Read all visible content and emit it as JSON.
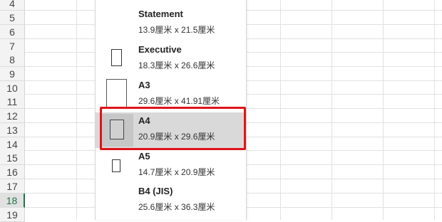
{
  "row_numbers": [
    "4",
    "5",
    "6",
    "7",
    "8",
    "9",
    "10",
    "11",
    "12",
    "13",
    "14",
    "15",
    "16",
    "17",
    "18",
    "19"
  ],
  "selected_row": "18",
  "paper_sizes": [
    {
      "name": "Statement",
      "dims": "13.9厘米  x  21.5厘米"
    },
    {
      "name": "Executive",
      "dims": "18.3厘米  x  26.6厘米"
    },
    {
      "name": "A3",
      "dims": "29.6厘米  x  41.91厘米"
    },
    {
      "name": "A4",
      "dims": "20.9厘米  x  29.6厘米",
      "selected": true
    },
    {
      "name": "A5",
      "dims": "14.7厘米  x  20.9厘米"
    },
    {
      "name": "B4 (JIS)",
      "dims": "25.6厘米  x  36.3厘米"
    }
  ],
  "colors": {
    "highlight": "#e0141b",
    "selected_row_header": "#217346"
  }
}
